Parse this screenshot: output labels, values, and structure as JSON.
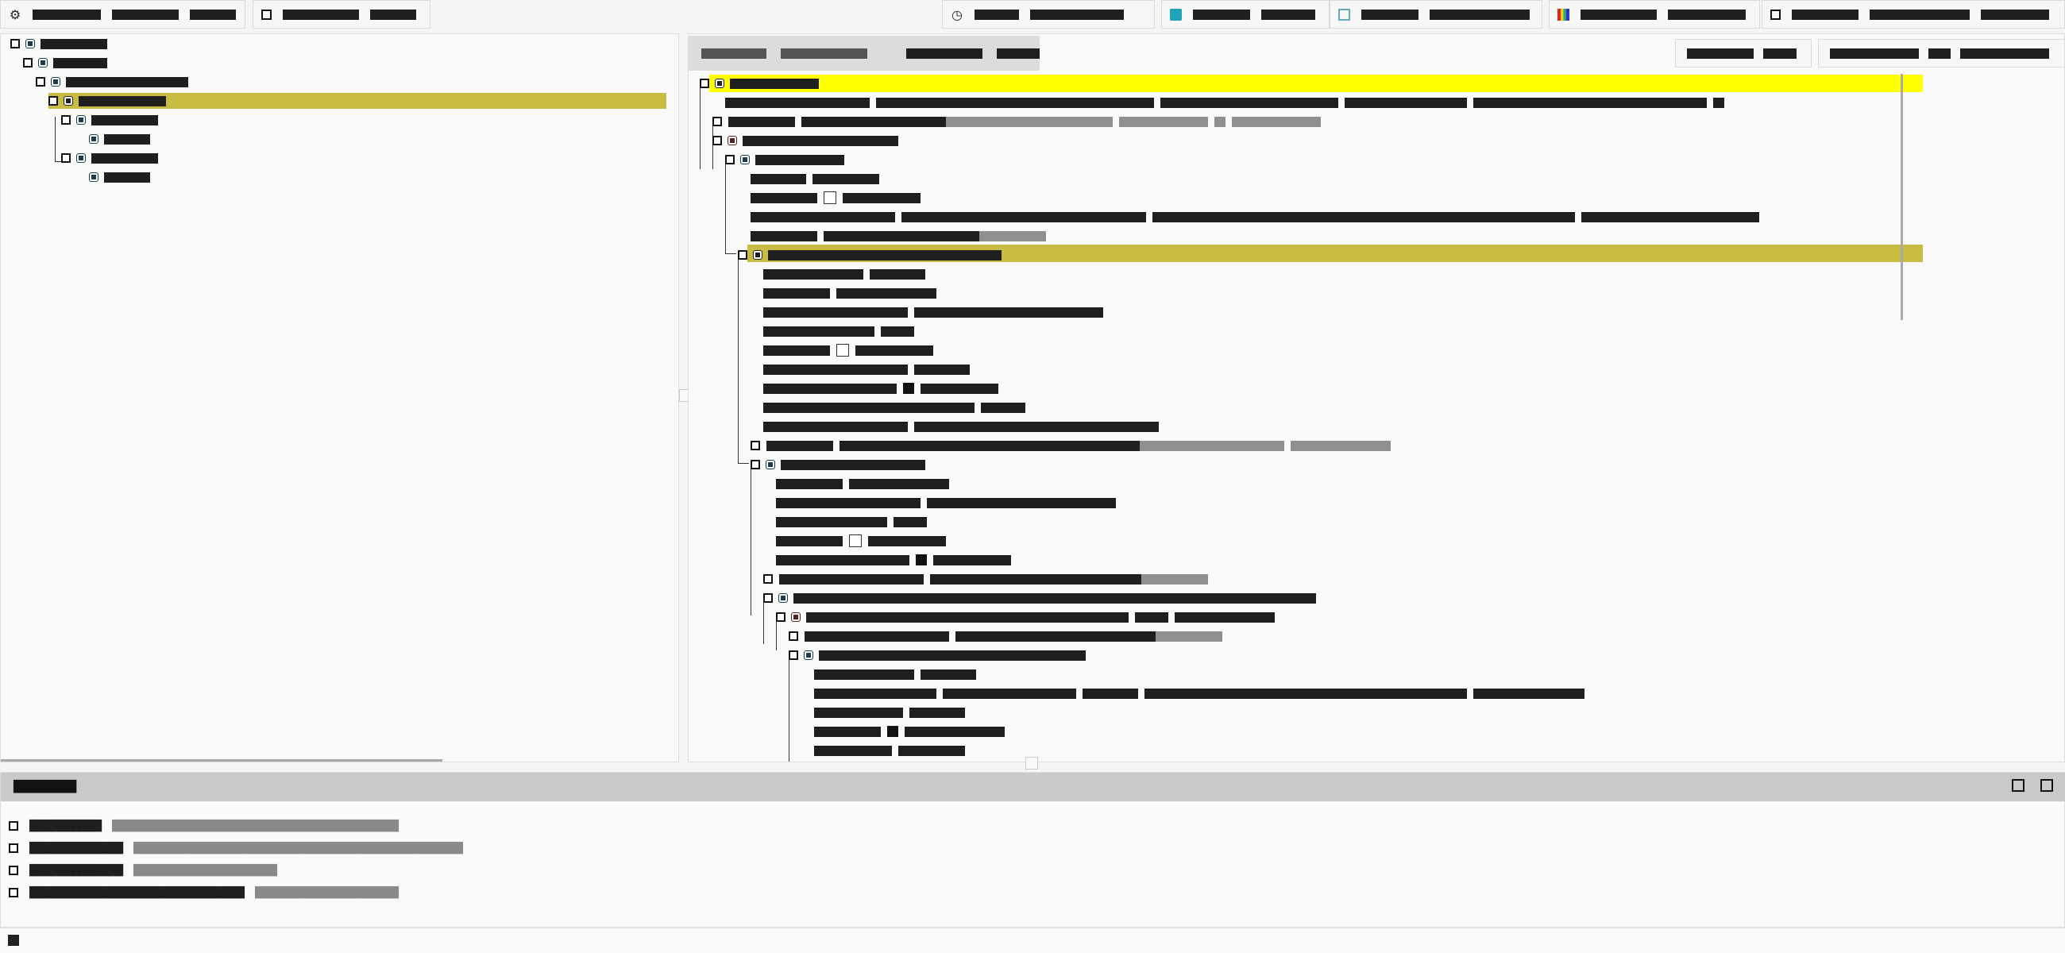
{
  "toolbar": {
    "btn1": [
      "█████████",
      "█████████",
      "██████"
    ],
    "btn2": [
      "██████████",
      "██████"
    ],
    "btn3": [
      "██████",
      "████████████"
    ],
    "btn4": [
      "███████",
      "███████"
    ],
    "btn5": [
      "██████",
      "███████████"
    ],
    "btn6": [
      "██▄████",
      "█████████"
    ],
    "btn7": [
      "████████",
      "████████████",
      "████████"
    ]
  },
  "bottom_panel": {
    "title": "████████",
    "rows": [
      {
        "key": "██████████",
        "value": "████████████████████████████████████████"
      },
      {
        "key": "█████████████",
        "value": "██████████████████████████████████████████████"
      },
      {
        "key": "█████████████",
        "value": "████████████████████"
      },
      {
        "key": "██████████████████████████████",
        "value": "████████████████████"
      }
    ]
  },
  "colors": {
    "selection_yellow": "#ffff00",
    "selection_olive": "#c8bc42",
    "accent_cyan": "#1ea3b8"
  }
}
